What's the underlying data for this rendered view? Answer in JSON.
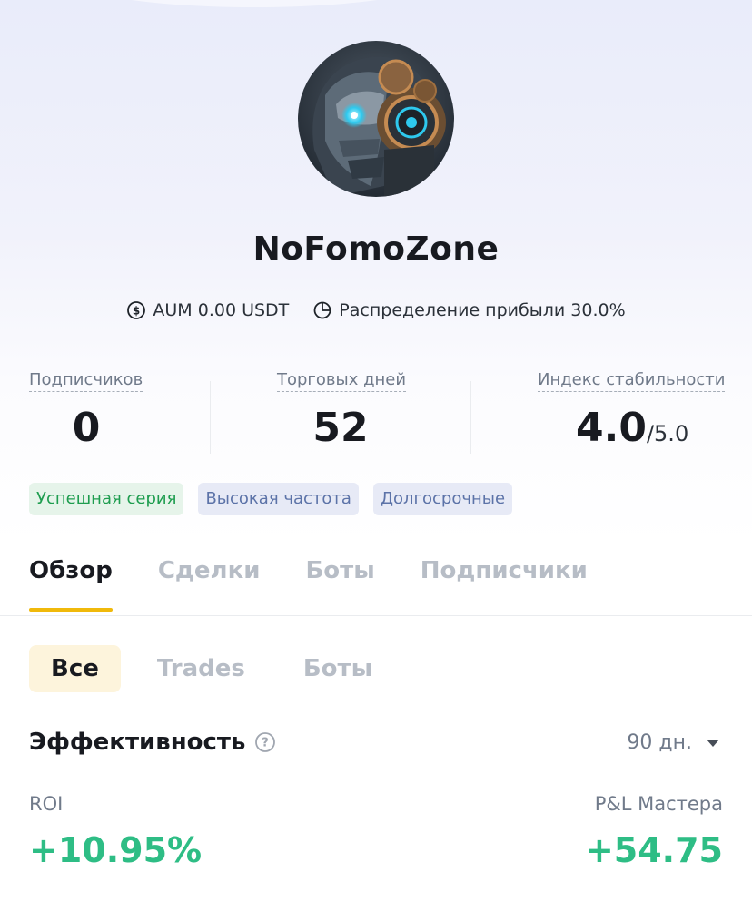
{
  "profile": {
    "name": "NoFomoZone",
    "avatar_icon": "robot-portrait-avatar"
  },
  "meta": {
    "aum_label": "AUM",
    "aum_value": "0.00 USDT",
    "profit_share_label": "Распределение прибыли",
    "profit_share_value": "30.0%"
  },
  "stats": {
    "followers": {
      "label": "Подписчиков",
      "value": "0"
    },
    "trading_days": {
      "label": "Торговых дней",
      "value": "52"
    },
    "stability": {
      "label": "Индекс стабильности",
      "value": "4.0",
      "suffix": "/5.0"
    }
  },
  "tags": [
    "Успешная серия",
    "Высокая частота",
    "Долгосрочные"
  ],
  "tabs": [
    "Обзор",
    "Сделки",
    "Боты",
    "Подписчики"
  ],
  "active_tab": "Обзор",
  "subtabs": [
    "Все",
    "Trades",
    "Боты"
  ],
  "active_subtab": "Все",
  "performance": {
    "title": "Эффективность",
    "period": "90 дн.",
    "roi_label": "ROI",
    "roi_value": "+10.95%",
    "pnl_label": "P&L Мастера",
    "pnl_value": "+54.75"
  },
  "colors": {
    "accent": "#f0b90b",
    "positive": "#2ebd85",
    "tag_green_text": "#1e9d4f",
    "tag_blue_text": "#5c73a8"
  }
}
